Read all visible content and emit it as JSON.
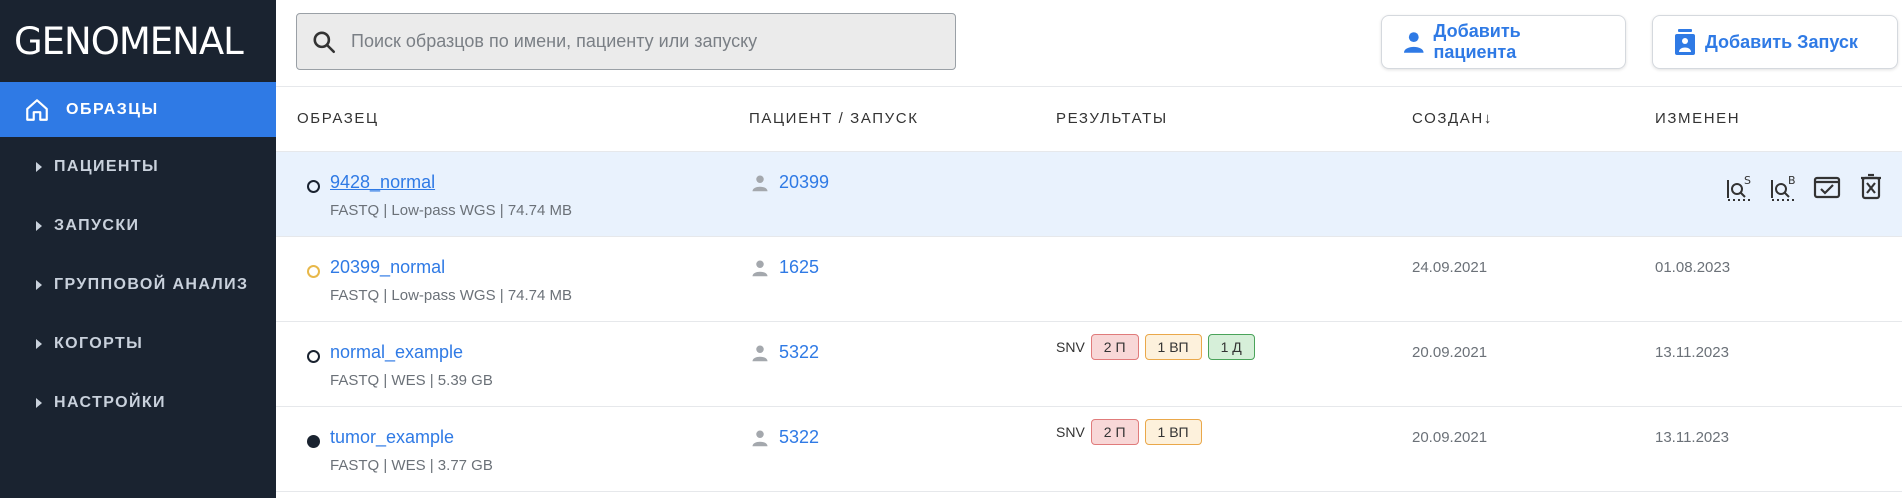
{
  "logo": "GENOMENAL",
  "sidebar": {
    "active": {
      "label": "ОБРАЗЦЫ",
      "icon": "home-icon"
    },
    "items": [
      {
        "label": "ПАЦИЕНТЫ"
      },
      {
        "label": "ЗАПУСКИ"
      },
      {
        "label": "ГРУППОВОЙ АНАЛИЗ"
      },
      {
        "label": "КОГОРТЫ"
      },
      {
        "label": "НАСТРОЙКИ"
      }
    ]
  },
  "search": {
    "placeholder": "Поиск образцов по имени, пациенту или запуску"
  },
  "buttons": {
    "add_patient": "Добавить пациента",
    "add_run": "Добавить Запуск"
  },
  "table": {
    "headers": {
      "sample": "ОБРАЗЕЦ",
      "patient_run": "ПАЦИЕНТ / ЗАПУСК",
      "results": "РЕЗУЛЬТАТЫ",
      "created": "СОЗДАН",
      "created_sort": "↓",
      "modified": "ИЗМЕНЕН"
    },
    "rows": [
      {
        "name": "9428_normal",
        "meta": "FASTQ | Low-pass WGS | 74.74 MB",
        "patient": "20399",
        "created": "",
        "modified": "",
        "status_color": "#1a2330",
        "status_fill": "none"
      },
      {
        "name": "20399_normal",
        "meta": "FASTQ | Low-pass WGS | 74.74 MB",
        "patient": "1625",
        "created": "24.09.2021",
        "modified": "01.08.2023",
        "status_color": "#e8b84a",
        "status_fill": "none"
      },
      {
        "name": "normal_example",
        "meta": "FASTQ | WES | 5.39 GB",
        "patient": "5322",
        "created": "20.09.2021",
        "modified": "13.11.2023",
        "status_color": "#1a2330",
        "status_fill": "none",
        "results": {
          "label": "SNV",
          "badges": [
            "2 П",
            "1 ВП",
            "1 Д"
          ]
        }
      },
      {
        "name": "tumor_example",
        "meta": "FASTQ | WES | 3.77 GB",
        "patient": "5322",
        "created": "20.09.2021",
        "modified": "13.11.2023",
        "status_color": "#1a2330",
        "status_fill": "#1a2330",
        "results": {
          "label": "SNV",
          "badges": [
            "2 П",
            "1 ВП"
          ]
        }
      }
    ],
    "row_actions": {
      "idS_label": "S",
      "idB_label": "B"
    }
  },
  "colors": {
    "accent": "#2f7ae5",
    "sidebar_bg": "#1a2330",
    "selected_row": "#e9f2fd"
  }
}
